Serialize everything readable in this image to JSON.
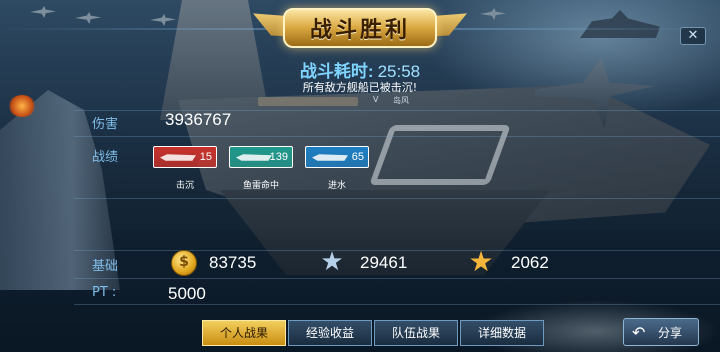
{
  "header": {
    "title": "战斗胜利",
    "close_label": "✕"
  },
  "battle": {
    "time_label": "战斗耗时:",
    "time_value": "25:58",
    "result_text": "所有敌方舰船已被击沉!",
    "mvp_rank": "V",
    "mvp_name": "岛风"
  },
  "stats": {
    "damage_label": "伤害",
    "damage_value": "3936767",
    "achievement_label": "战绩",
    "base_label": "基础",
    "pt_label": "PT :",
    "pt_value": "5000"
  },
  "medals": [
    {
      "icon": "ship-sink-icon",
      "count": "15",
      "caption": "击沉",
      "color": "#c8312a"
    },
    {
      "icon": "torpedo-icon",
      "count": "139",
      "caption": "鱼雷命中",
      "color": "#1f9a8d"
    },
    {
      "icon": "flooding-icon",
      "count": "65",
      "caption": "进水",
      "color": "#1c7fc4"
    }
  ],
  "resources": [
    {
      "icon": "gold-coin-icon",
      "symbol": "$",
      "value": "83735"
    },
    {
      "icon": "silver-star-icon",
      "symbol": "★",
      "value": "29461"
    },
    {
      "icon": "gold-star-icon",
      "symbol": "★",
      "value": "2062"
    }
  ],
  "tabs": [
    {
      "label": "个人战果",
      "active": true
    },
    {
      "label": "经验收益",
      "active": false
    },
    {
      "label": "队伍战果",
      "active": false
    },
    {
      "label": "详细数据",
      "active": false
    }
  ],
  "share": {
    "icon": "↶",
    "label": "分享"
  }
}
